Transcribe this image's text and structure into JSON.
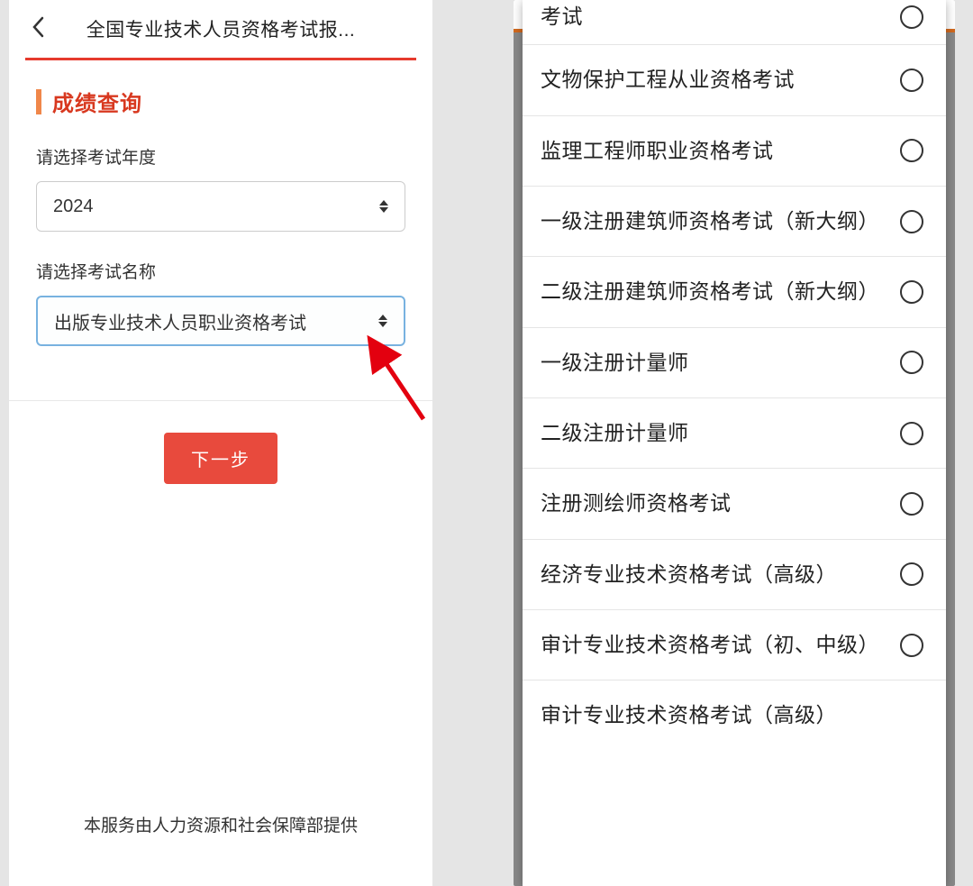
{
  "leftPhone": {
    "headerTitle": "全国专业技术人员资格考试报...",
    "sectionTitle": "成绩查询",
    "yearLabel": "请选择考试年度",
    "yearValue": "2024",
    "examLabel": "请选择考试名称",
    "examValue": "出版专业技术人员职业资格考试",
    "nextButton": "下一步",
    "footerText": "本服务由人力资源和社会保障部提供"
  },
  "rightPhone": {
    "partialTopOption": "考试",
    "options": [
      "文物保护工程从业资格考试",
      "监理工程师职业资格考试",
      "一级注册建筑师资格考试（新大纲）",
      "二级注册建筑师资格考试（新大纲）",
      "一级注册计量师",
      "二级注册计量师",
      "注册测绘师资格考试",
      "经济专业技术资格考试（高级）",
      "审计专业技术资格考试（初、中级）",
      "审计专业技术资格考试（高级）"
    ]
  }
}
